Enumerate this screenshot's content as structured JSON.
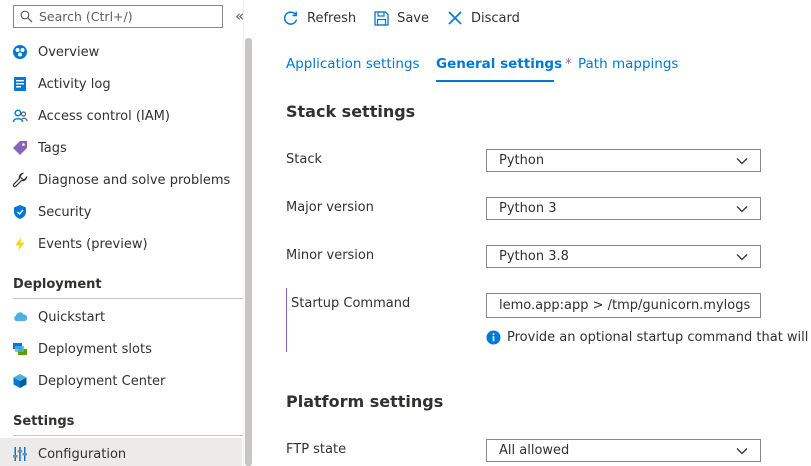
{
  "sidebar": {
    "search_placeholder": "Search (Ctrl+/)",
    "collapse_glyph": "«",
    "items": [
      {
        "label": "Overview",
        "icon": "overview-icon"
      },
      {
        "label": "Activity log",
        "icon": "activity-log-icon"
      },
      {
        "label": "Access control (IAM)",
        "icon": "access-control-icon"
      },
      {
        "label": "Tags",
        "icon": "tag-icon"
      },
      {
        "label": "Diagnose and solve problems",
        "icon": "wrench-icon"
      },
      {
        "label": "Security",
        "icon": "shield-icon"
      },
      {
        "label": "Events (preview)",
        "icon": "lightning-icon"
      }
    ],
    "sections": [
      {
        "title": "Deployment",
        "items": [
          {
            "label": "Quickstart",
            "icon": "cloud-icon"
          },
          {
            "label": "Deployment slots",
            "icon": "deployment-slots-icon"
          },
          {
            "label": "Deployment Center",
            "icon": "cube-icon"
          }
        ]
      },
      {
        "title": "Settings",
        "items": [
          {
            "label": "Configuration",
            "icon": "configuration-icon",
            "selected": true
          }
        ]
      }
    ]
  },
  "toolbar": {
    "refresh": "Refresh",
    "save": "Save",
    "discard": "Discard"
  },
  "tabs": {
    "application": "Application settings",
    "general": "General settings",
    "general_marker": "*",
    "path": "Path mappings",
    "active": "General settings"
  },
  "stack": {
    "heading": "Stack settings",
    "stack_label": "Stack",
    "stack_value": "Python",
    "major_label": "Major version",
    "major_value": "Python 3",
    "minor_label": "Minor version",
    "minor_value": "Python 3.8",
    "startup_label": "Startup Command",
    "startup_value": "lemo.app:app > /tmp/gunicorn.mylogs",
    "startup_info": "Provide an optional startup command that will be"
  },
  "platform": {
    "heading": "Platform settings",
    "ftp_label": "FTP state",
    "ftp_value": "All allowed"
  },
  "colors": {
    "accent": "#0078d4",
    "modified_marker": "#8764b8",
    "selected_bg": "#edebe9"
  }
}
